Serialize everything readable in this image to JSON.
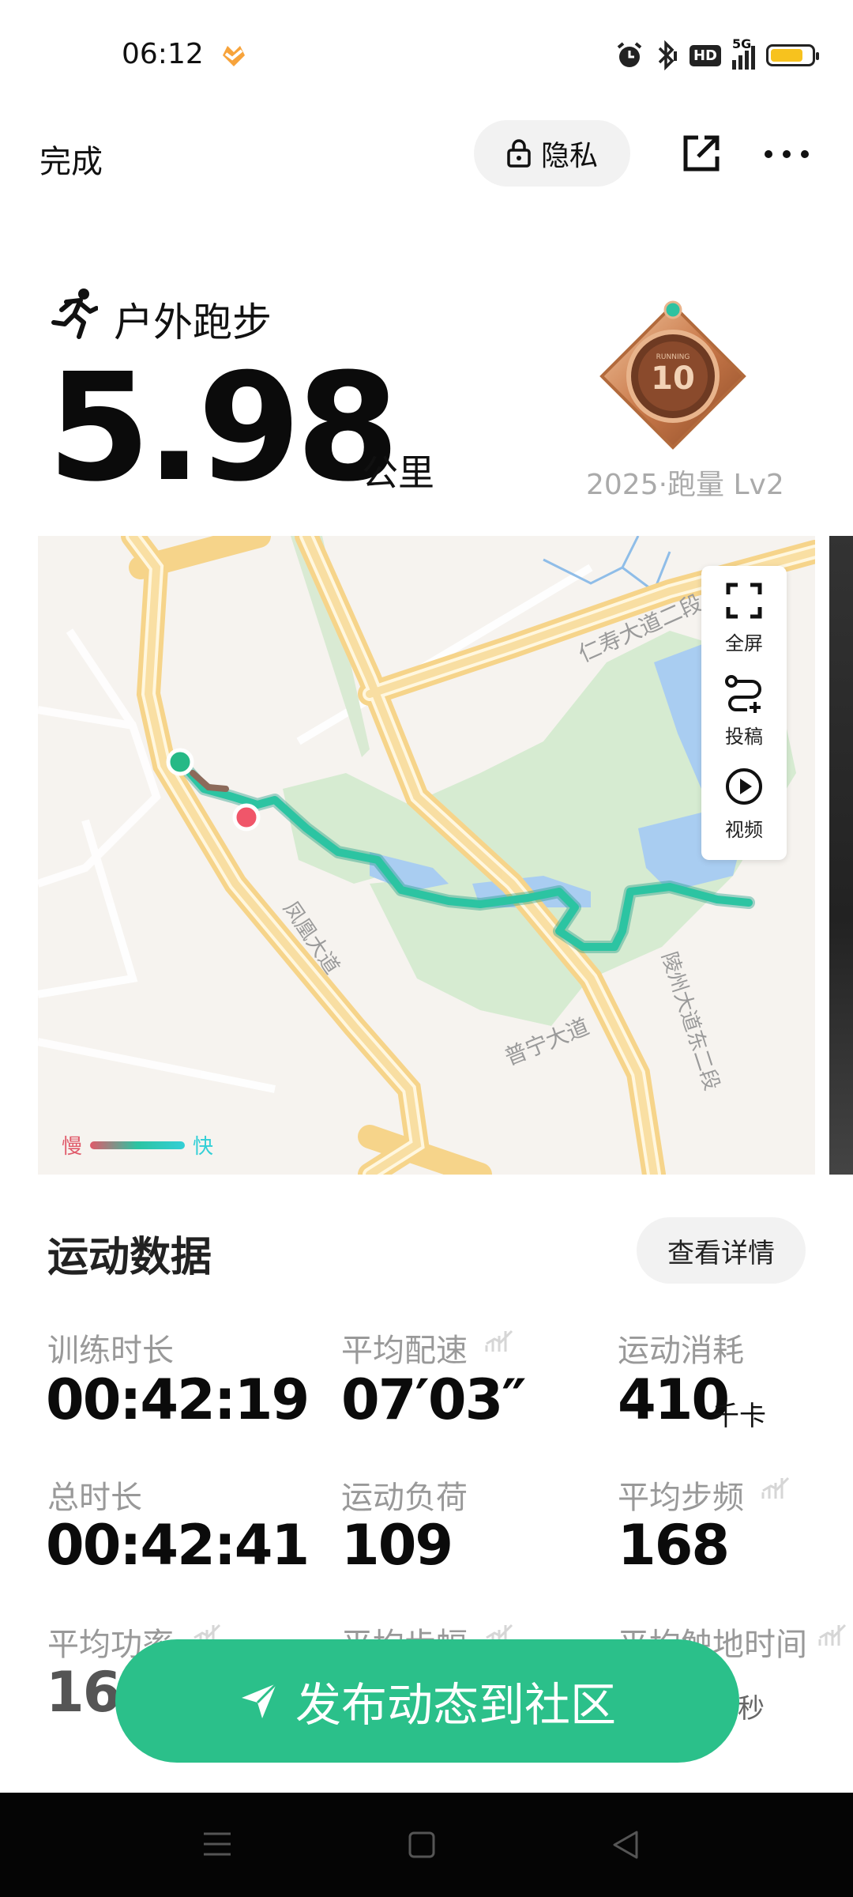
{
  "status_bar": {
    "time": "06:12",
    "network": "5G",
    "hd": "HD",
    "battery_level": 0.8,
    "icons": [
      "heart-app-icon",
      "alarm-icon",
      "bluetooth-icon",
      "hd-icon",
      "signal-icon",
      "battery-icon"
    ]
  },
  "header": {
    "done_label": "完成",
    "privacy_label": "隐私",
    "icons": [
      "lock-icon",
      "share-icon",
      "more-icon"
    ]
  },
  "summary": {
    "activity_type": "户外跑步",
    "distance": "5.98",
    "distance_unit": "公里",
    "medal_label": "2025·跑量 Lv2",
    "medal_text": "10",
    "medal_small_text": "RUNNING"
  },
  "map": {
    "roads": [
      "仁寿大道二段",
      "凤凰大道",
      "陵州大道东二段",
      "普宁大道"
    ],
    "controls": [
      {
        "icon": "fullscreen-icon",
        "label": "全屏"
      },
      {
        "icon": "route-icon",
        "label": "投稿"
      },
      {
        "icon": "play-icon",
        "label": "视频"
      }
    ],
    "legend_slow": "慢",
    "legend_fast": "快"
  },
  "stats": {
    "title": "运动数据",
    "details_label": "查看详情",
    "items": [
      {
        "label": "训练时长",
        "value": "00:42:19"
      },
      {
        "label": "平均配速",
        "value": "07′03″"
      },
      {
        "label": "运动消耗",
        "value": "410",
        "unit": "千卡"
      },
      {
        "label": "总时长",
        "value": "00:42:41"
      },
      {
        "label": "运动负荷",
        "value": "109"
      },
      {
        "label": "平均步频",
        "value": "168"
      },
      {
        "label": "平均功率",
        "value": "161"
      },
      {
        "label": "平均步幅",
        "value": ""
      },
      {
        "label": "平均触地时间",
        "value": "",
        "unit": "毫秒"
      }
    ]
  },
  "publish_label": "发布动态到社区",
  "colors": {
    "accent": "#2bc08a",
    "route_start": "#26b986",
    "route_end": "#f0566a",
    "slow": "#e05a6a",
    "fast": "#33cfd6"
  }
}
